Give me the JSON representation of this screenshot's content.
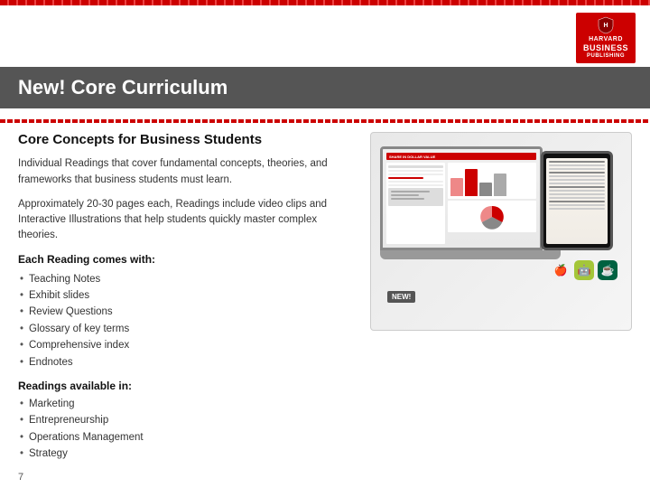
{
  "header": {
    "logo": {
      "line1": "HARVARD",
      "line2": "BUSINESS",
      "line3": "PUBLISHING"
    }
  },
  "title_banner": {
    "text": "New! Core Curriculum"
  },
  "section": {
    "title": "Core Concepts for Business Students",
    "intro1": "Individual Readings that cover fundamental concepts, theories, and frameworks that business students must learn.",
    "intro2": "Approximately 20-30 pages each, Readings include video clips and Interactive Illustrations that help students quickly master complex theories.",
    "each_reading_title": "Each Reading comes with:",
    "each_reading_items": [
      "Teaching Notes",
      "Exhibit slides",
      "Review Questions",
      "Glossary of key terms",
      "Comprehensive index",
      "Endnotes"
    ],
    "readings_available_title": "Readings available in:",
    "readings_available_items": [
      "Marketing",
      "Entrepreneurship",
      "Operations Management",
      "Strategy"
    ],
    "page_number": "7"
  },
  "image": {
    "new_badge": "NEW!"
  },
  "chart": {
    "bars": [
      {
        "color": "#e88",
        "height": 20
      },
      {
        "color": "#c00",
        "height": 30
      },
      {
        "color": "#888",
        "height": 15
      },
      {
        "color": "#aaa",
        "height": 25
      }
    ]
  }
}
